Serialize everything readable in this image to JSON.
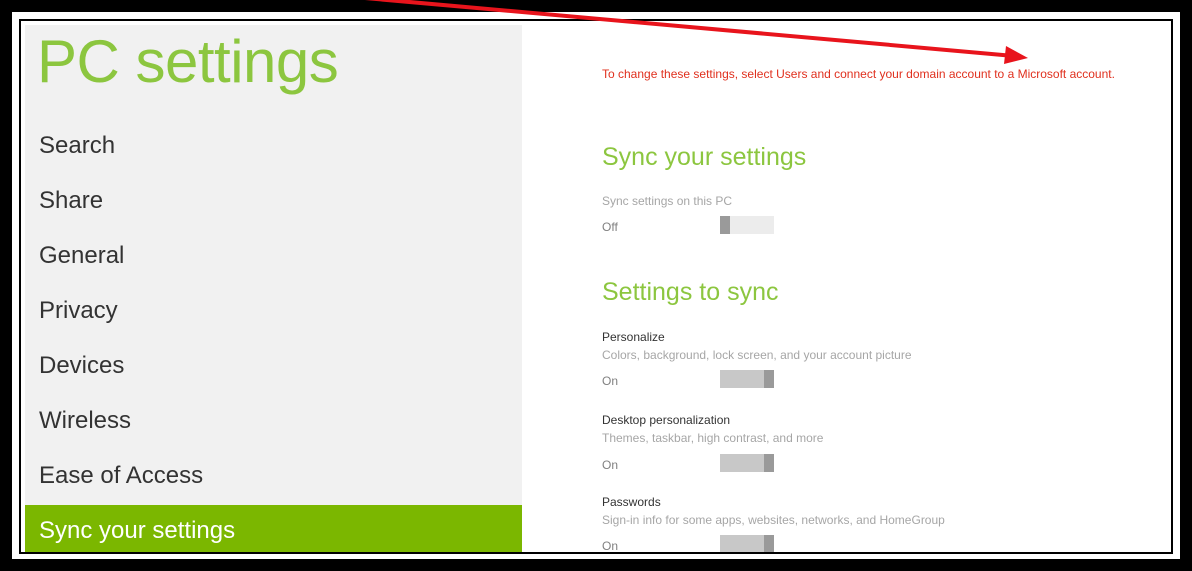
{
  "app": {
    "title": "PC settings"
  },
  "sidebar": {
    "items": [
      {
        "label": "Search",
        "selected": false
      },
      {
        "label": "Share",
        "selected": false
      },
      {
        "label": "General",
        "selected": false
      },
      {
        "label": "Privacy",
        "selected": false
      },
      {
        "label": "Devices",
        "selected": false
      },
      {
        "label": "Wireless",
        "selected": false
      },
      {
        "label": "Ease of Access",
        "selected": false
      },
      {
        "label": "Sync your settings",
        "selected": true
      }
    ]
  },
  "main": {
    "notice": "To change these settings, select Users and connect your domain account to a Microsoft account.",
    "sync_section": {
      "heading": "Sync your settings",
      "setting_label": "Sync settings on this PC",
      "state": "Off",
      "enabled": false
    },
    "settings_to_sync": {
      "heading": "Settings to sync",
      "items": [
        {
          "title": "Personalize",
          "description": "Colors, background, lock screen, and your account picture",
          "state": "On",
          "enabled": true
        },
        {
          "title": "Desktop personalization",
          "description": "Themes, taskbar, high contrast, and more",
          "state": "On",
          "enabled": true
        },
        {
          "title": "Passwords",
          "description": "Sign-in info for some apps, websites, networks, and HomeGroup",
          "state": "On",
          "enabled": true
        }
      ]
    }
  },
  "colors": {
    "accent_green": "#8cc63f",
    "selected_bg": "#7bb700",
    "notice_red": "#e0301e",
    "annotation_arrow": "#e8141c"
  }
}
